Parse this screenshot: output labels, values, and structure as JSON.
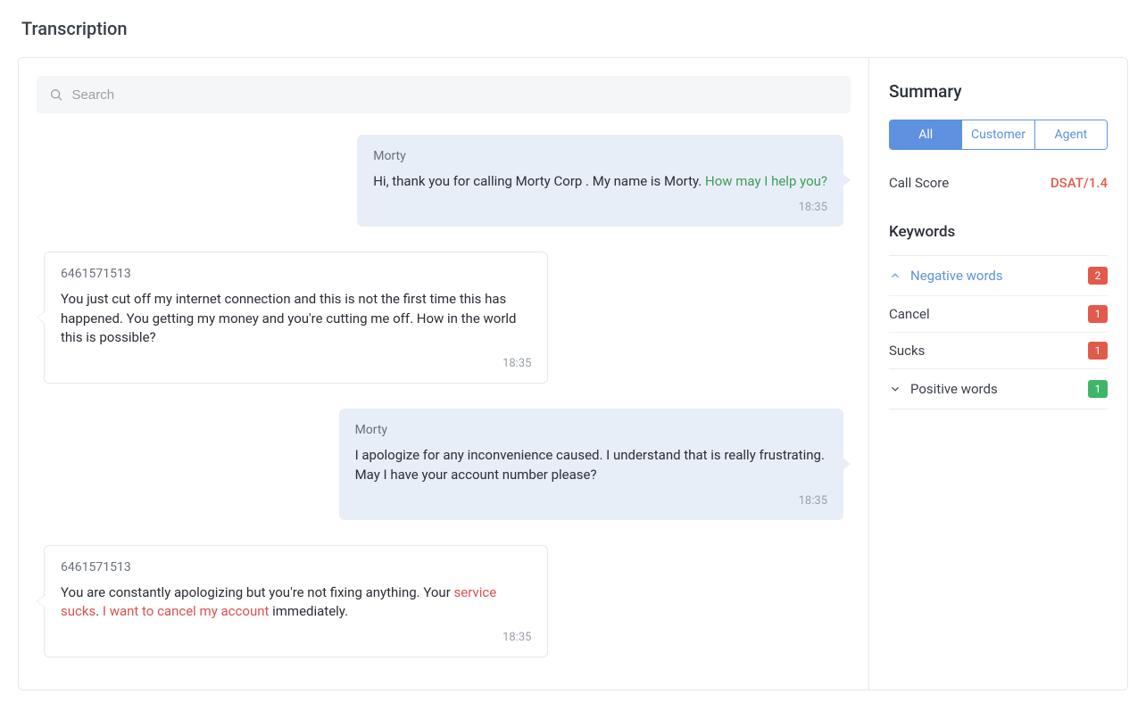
{
  "page_title": "Transcription",
  "search": {
    "placeholder": "Search"
  },
  "messages": [
    {
      "role": "agent",
      "speaker": "Morty",
      "segments": [
        {
          "text": "Hi, thank you for calling Morty Corp . My name is Morty. ",
          "kind": "plain"
        },
        {
          "text": "How may I help you?",
          "kind": "pos"
        }
      ],
      "time": "18:35"
    },
    {
      "role": "customer",
      "speaker": "6461571513",
      "segments": [
        {
          "text": "You just cut off my internet connection and this is not the first time this has happened. You getting my money and you're cutting me off. How in the world this is possible?",
          "kind": "plain"
        }
      ],
      "time": "18:35"
    },
    {
      "role": "agent",
      "speaker": "Morty",
      "segments": [
        {
          "text": "I apologize for any inconvenience caused. I understand that is really frustrating. May I have your account number please?",
          "kind": "plain"
        }
      ],
      "time": "18:35"
    },
    {
      "role": "customer",
      "speaker": "6461571513",
      "segments": [
        {
          "text": "You are constantly apologizing but you're not fixing anything. Your ",
          "kind": "plain"
        },
        {
          "text": "service sucks",
          "kind": "neg"
        },
        {
          "text": ". ",
          "kind": "plain"
        },
        {
          "text": "I want to cancel my account",
          "kind": "neg"
        },
        {
          "text": " immediately.",
          "kind": "plain"
        }
      ],
      "time": "18:35"
    }
  ],
  "summary": {
    "title": "Summary",
    "tabs": [
      "All",
      "Customer",
      "Agent"
    ],
    "active_tab": 0,
    "call_score_label": "Call Score",
    "call_score_value": "DSAT/1.4",
    "keywords_title": "Keywords",
    "groups": [
      {
        "name": "Negative words",
        "count": 2,
        "expanded": true,
        "badge_color": "red",
        "items": [
          {
            "word": "Cancel",
            "count": 1
          },
          {
            "word": "Sucks",
            "count": 1
          }
        ]
      },
      {
        "name": "Positive words",
        "count": 1,
        "expanded": false,
        "badge_color": "green",
        "items": []
      }
    ]
  }
}
